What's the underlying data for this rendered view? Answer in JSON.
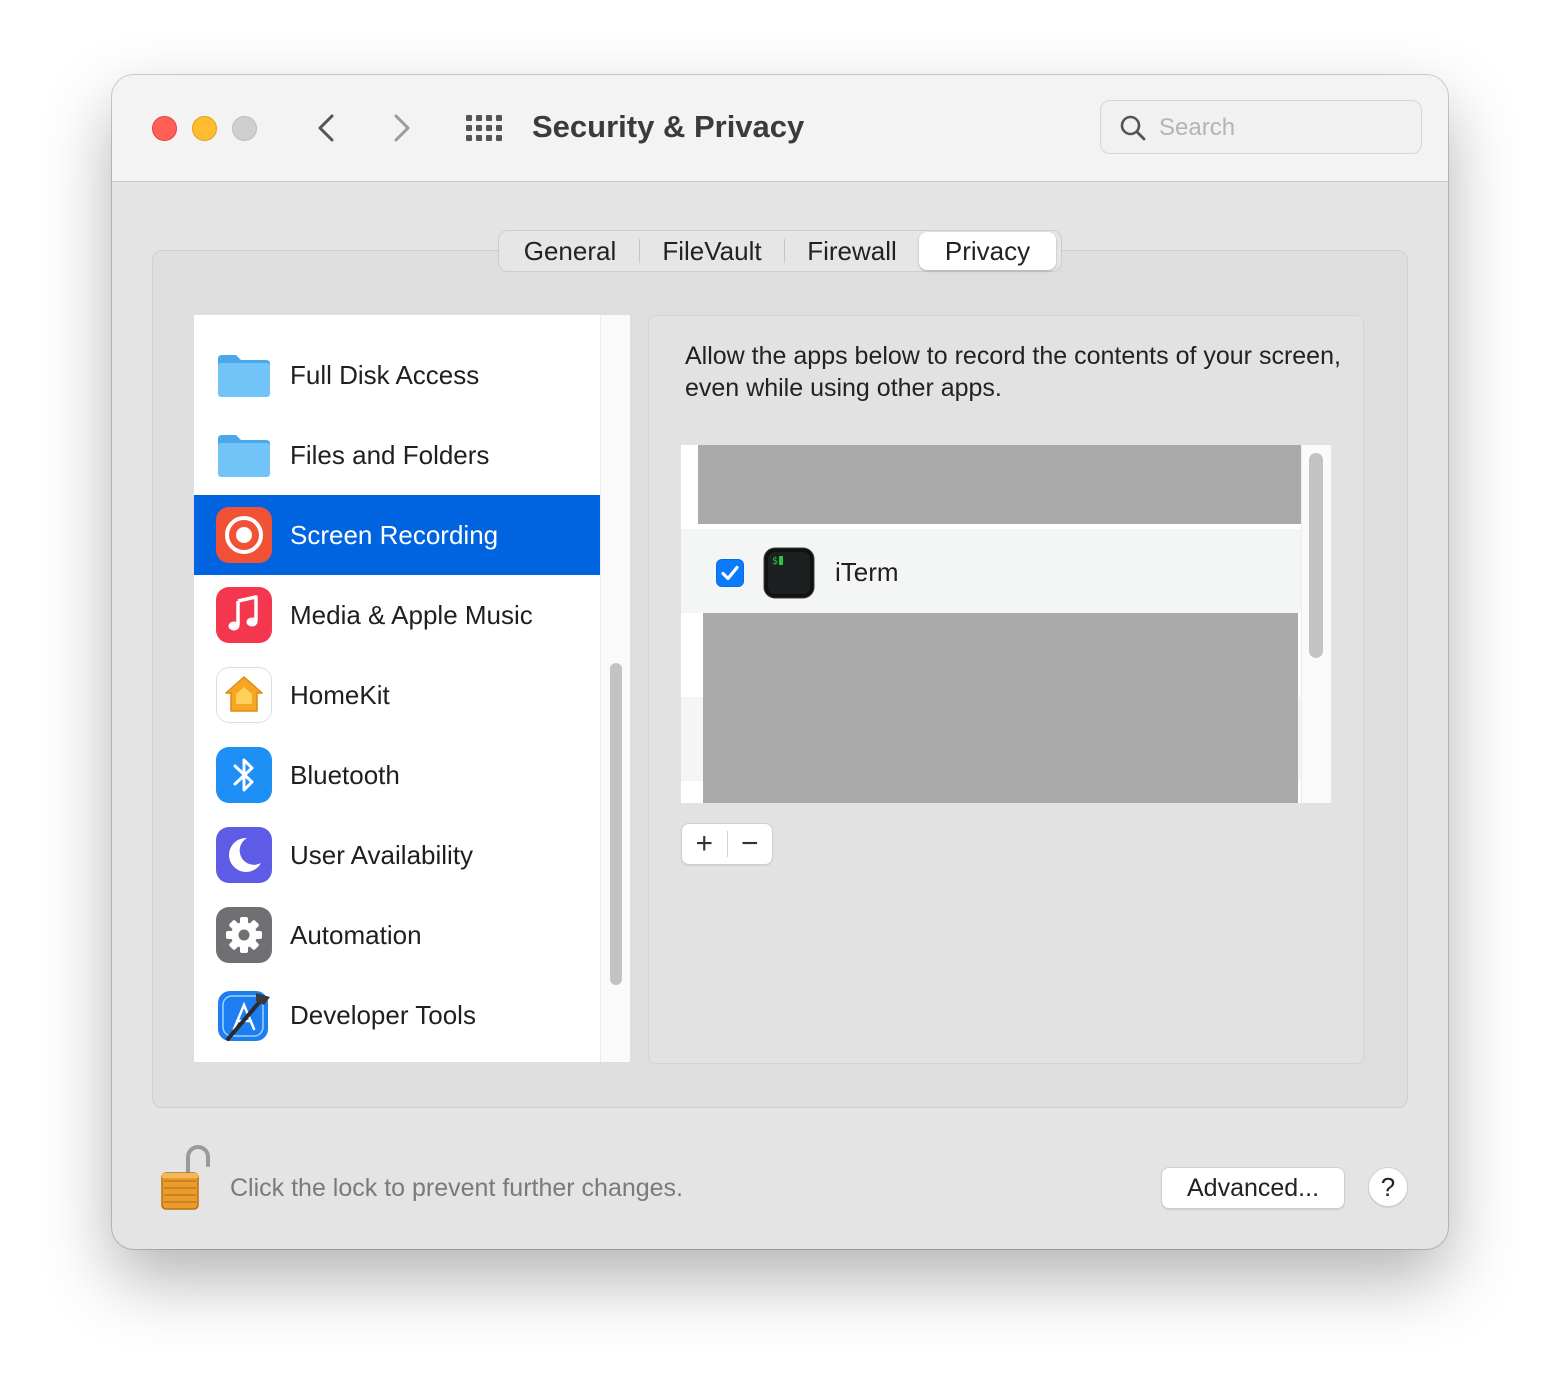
{
  "window": {
    "title": "Security & Privacy",
    "traffic_lights": {
      "close": "#ff5f57",
      "minimize": "#febc2e",
      "zoom": "#cfcfcf"
    },
    "nav": {
      "back_icon": "chevron-left-icon",
      "forward_icon": "chevron-right-icon",
      "grid_icon": "grid-icon"
    }
  },
  "search": {
    "placeholder": "Search",
    "value": ""
  },
  "tabs": [
    {
      "label": "General",
      "selected": false
    },
    {
      "label": "FileVault",
      "selected": false
    },
    {
      "label": "Firewall",
      "selected": false
    },
    {
      "label": "Privacy",
      "selected": true
    }
  ],
  "sidebar": {
    "items": [
      {
        "label": "Full Disk Access",
        "icon": "folder-icon",
        "selected": false
      },
      {
        "label": "Files and Folders",
        "icon": "folder-icon",
        "selected": false
      },
      {
        "label": "Screen Recording",
        "icon": "screen-recording-icon",
        "selected": true
      },
      {
        "label": "Media & Apple Music",
        "icon": "music-icon",
        "selected": false
      },
      {
        "label": "HomeKit",
        "icon": "homekit-icon",
        "selected": false
      },
      {
        "label": "Bluetooth",
        "icon": "bluetooth-icon",
        "selected": false
      },
      {
        "label": "User Availability",
        "icon": "moon-icon",
        "selected": false
      },
      {
        "label": "Automation",
        "icon": "gear-icon",
        "selected": false
      },
      {
        "label": "Developer Tools",
        "icon": "developer-tools-icon",
        "selected": false
      }
    ],
    "selected_color": "#0064e1"
  },
  "detail": {
    "description": "Allow the apps below to record the contents of your screen, even while using other apps.",
    "apps": [
      {
        "name": "iTerm",
        "checked": true,
        "icon": "terminal-icon"
      }
    ],
    "add_label": "+",
    "remove_label": "−"
  },
  "footer": {
    "lock_text": "Click the lock to prevent further changes.",
    "lock_icon": "unlocked-padlock-icon",
    "advanced_label": "Advanced...",
    "help_label": "?"
  }
}
